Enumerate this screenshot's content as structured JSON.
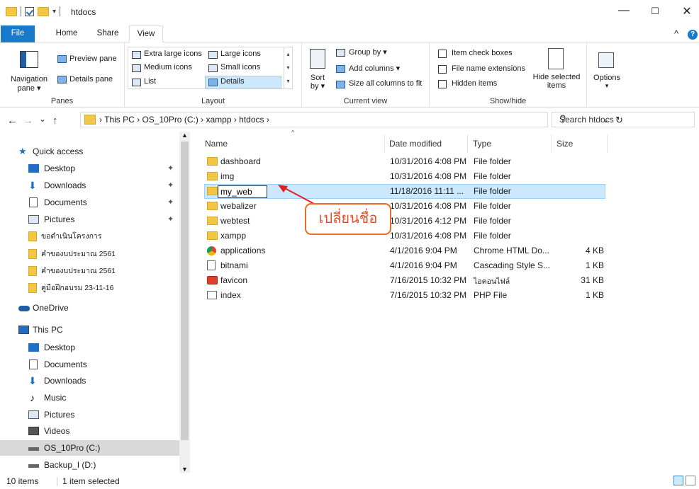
{
  "window": {
    "title": "htdocs",
    "minimize": "—",
    "maximize": "☐",
    "close": "✕",
    "collapse_ribbon": "^",
    "help": "?"
  },
  "tabs": [
    {
      "label": "File"
    },
    {
      "label": "Home"
    },
    {
      "label": "Share"
    },
    {
      "label": "View"
    }
  ],
  "ribbon": {
    "panes": {
      "navigation_pane": "Navigation pane ▾",
      "preview_pane": "Preview pane",
      "details_pane": "Details pane",
      "label": "Panes"
    },
    "layout": {
      "extra_large_icons": "Extra large icons",
      "large_icons": "Large icons",
      "medium_icons": "Medium icons",
      "small_icons": "Small icons",
      "list": "List",
      "details": "Details",
      "label": "Layout"
    },
    "current_view": {
      "sort_by": "Sort by ▾",
      "group_by": "Group by ▾",
      "add_columns": "Add columns ▾",
      "size_all_columns": "Size all columns to fit",
      "label": "Current view"
    },
    "show_hide": {
      "item_check_boxes": "Item check boxes",
      "file_name_extensions": "File name extensions",
      "hidden_items": "Hidden items",
      "hide_selected_items": "Hide selected items",
      "label": "Show/hide"
    },
    "options": {
      "label": "Options",
      "arrow": "▾"
    }
  },
  "address": {
    "back": "←",
    "forward": "→",
    "recent": "⌄",
    "up": "↑",
    "path": "› This PC › OS_10Pro (C:) › xampp › htdocs ›",
    "dropdown": "⌄",
    "refresh": "↻",
    "search_placeholder": "Search htdocs",
    "search_icon": "⚲"
  },
  "nav": {
    "scroll_up": "▲",
    "scroll_down": "▼",
    "pin": "✦",
    "items": [
      {
        "label": "Quick access",
        "icon": "star-icon"
      },
      {
        "label": "Desktop",
        "icon": "desktop-icon",
        "pinned": true
      },
      {
        "label": "Downloads",
        "icon": "download-icon",
        "pinned": true
      },
      {
        "label": "Documents",
        "icon": "documents-icon",
        "pinned": true
      },
      {
        "label": "Pictures",
        "icon": "pictures-icon",
        "pinned": true
      },
      {
        "label": "ขอดำเนินโครงการ",
        "icon": "folder-icon"
      },
      {
        "label": "คำของบประมาณ 2561",
        "icon": "folder-icon"
      },
      {
        "label": "คำของบประมาณ 2561",
        "icon": "folder-icon"
      },
      {
        "label": "คู่มือฝึกอบรม 23-11-16",
        "icon": "folder-icon"
      },
      {
        "label": "OneDrive",
        "icon": "cloud-icon"
      },
      {
        "label": "This PC",
        "icon": "computer-icon"
      },
      {
        "label": "Desktop",
        "icon": "desktop-icon"
      },
      {
        "label": "Documents",
        "icon": "documents-icon"
      },
      {
        "label": "Downloads",
        "icon": "download-icon"
      },
      {
        "label": "Music",
        "icon": "music-icon"
      },
      {
        "label": "Pictures",
        "icon": "pictures-icon"
      },
      {
        "label": "Videos",
        "icon": "videos-icon"
      },
      {
        "label": "OS_10Pro (C:)",
        "icon": "drive-icon",
        "selected": true
      },
      {
        "label": "Backup_I (D:)",
        "icon": "drive-icon"
      }
    ]
  },
  "columns": {
    "name": "Name",
    "date": "Date modified",
    "type": "Type",
    "size": "Size"
  },
  "files": [
    {
      "name": "dashboard",
      "date": "10/31/2016 4:08 PM",
      "type": "File folder",
      "size": "",
      "icon": "folder-icon"
    },
    {
      "name": "img",
      "date": "10/31/2016 4:08 PM",
      "type": "File folder",
      "size": "",
      "icon": "folder-icon"
    },
    {
      "name": "my_web",
      "date": "11/18/2016 11:11 ...",
      "type": "File folder",
      "size": "",
      "icon": "folder-icon",
      "renaming": true
    },
    {
      "name": "webalizer",
      "date": "10/31/2016 4:08 PM",
      "type": "File folder",
      "size": "",
      "icon": "folder-icon"
    },
    {
      "name": "webtest",
      "date": "10/31/2016 4:12 PM",
      "type": "File folder",
      "size": "",
      "icon": "folder-icon"
    },
    {
      "name": "xampp",
      "date": "10/31/2016 4:08 PM",
      "type": "File folder",
      "size": "",
      "icon": "folder-icon"
    },
    {
      "name": "applications",
      "date": "4/1/2016 9:04 PM",
      "type": "Chrome HTML Do...",
      "size": "4 KB",
      "icon": "chrome-icon"
    },
    {
      "name": "bitnami",
      "date": "4/1/2016 9:04 PM",
      "type": "Cascading Style S...",
      "size": "1 KB",
      "icon": "css-file-icon"
    },
    {
      "name": "favicon",
      "date": "7/16/2015 10:32 PM",
      "type": "ไอคอนไฟล์",
      "size": "31 KB",
      "icon": "xampp-icon"
    },
    {
      "name": "index",
      "date": "7/16/2015 10:32 PM",
      "type": "PHP File",
      "size": "1 KB",
      "icon": "php-file-icon"
    }
  ],
  "annotation": {
    "text": "เปลี่ยนชื่อ",
    "color": "#e8692a"
  },
  "status": {
    "items": "10 items",
    "selected": "1 item selected"
  },
  "colors": {
    "accent": "#1979ca",
    "selection": "#cce8ff",
    "folder": "#f2c744"
  }
}
